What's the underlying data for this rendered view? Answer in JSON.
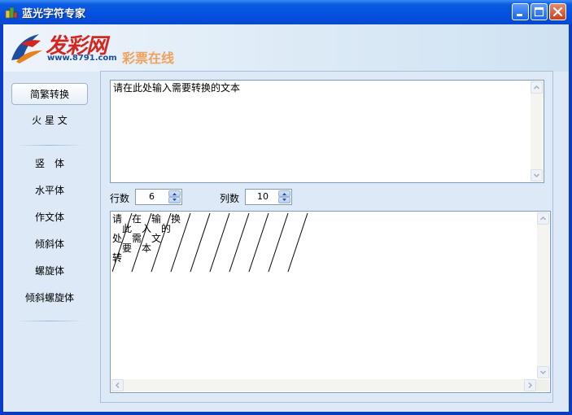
{
  "window": {
    "title": "蓝光字符专家"
  },
  "banner": {
    "logo_text": "发彩网",
    "logo_url": "www.8791.com",
    "slogan": "彩票在线"
  },
  "sidebar": {
    "items": [
      {
        "label": "简繁转换",
        "active": true
      },
      {
        "label": "火 星 文"
      },
      {
        "label": "竖　体"
      },
      {
        "label": "水平体"
      },
      {
        "label": "作文体"
      },
      {
        "label": "倾斜体"
      },
      {
        "label": "螺旋体"
      },
      {
        "label": "倾斜螺旋体"
      }
    ]
  },
  "input": {
    "text": "请在此处输入需要转换的文本"
  },
  "controls": {
    "rows_label": "行数",
    "rows_value": "6",
    "cols_label": "列数",
    "cols_value": "10"
  },
  "output": {
    "chars": [
      "请",
      "此",
      "处",
      "在",
      "要",
      "转",
      "输",
      "入",
      "需",
      "换",
      "的",
      "本",
      "文"
    ]
  },
  "colors": {
    "title_bar": "#0550e0",
    "client_bg": "#dde9f6",
    "logo_red": "#d3261f",
    "slogan_orange": "#f0a25c"
  },
  "icons": [
    "app-icon",
    "minimize-icon",
    "maximize-icon",
    "close-icon",
    "scroll-up-icon",
    "scroll-down-icon",
    "scroll-left-icon",
    "scroll-right-icon",
    "spin-up-icon",
    "spin-down-icon"
  ]
}
